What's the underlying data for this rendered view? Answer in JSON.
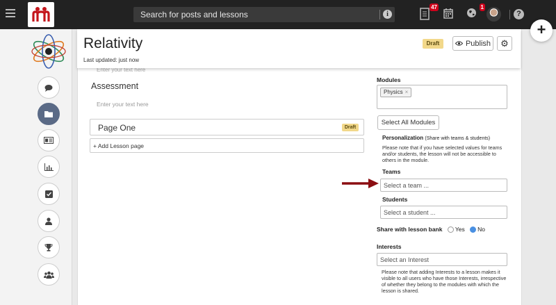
{
  "topbar": {
    "search_placeholder": "Search for posts and lessons",
    "info_glyph": "i",
    "notifications_count": "47",
    "globe_count": "1",
    "help_glyph": "?",
    "icons": [
      "hamburger-icon",
      "logo-icon",
      "info-icon",
      "notifications-icon",
      "calendar-icon",
      "globe-icon",
      "avatar",
      "help-icon"
    ]
  },
  "fab": {
    "label": "+"
  },
  "lesson": {
    "title": "Relativity",
    "last_updated": "Last updated: just now",
    "status": "Draft",
    "publish_label": "Publish",
    "faded_text": "Enter your text here"
  },
  "assessment": {
    "title": "Assessment",
    "placeholder": "Enter your text here"
  },
  "pages": [
    {
      "label": "Page One",
      "status": "Draft"
    }
  ],
  "add_page_label": "+ Add Lesson page",
  "modules": {
    "label": "Modules",
    "selected": [
      "Physics"
    ],
    "chip_remove": "×",
    "select_all_label": "Select All Modules"
  },
  "personalization": {
    "title": "Personalization",
    "subtitle": "(Share with teams & students)",
    "note": "Please note that if you have selected values for teams and/or students, the lesson will not be accessible to others in the module.",
    "teams_label": "Teams",
    "teams_placeholder": "Select a team ...",
    "students_label": "Students",
    "students_placeholder": "Select a student ..."
  },
  "share": {
    "label": "Share with lesson bank",
    "yes_label": "Yes",
    "no_label": "No",
    "selected": "No"
  },
  "interests": {
    "label": "Interests",
    "placeholder": "Select an Interest",
    "note": "Please note that adding Interests to a lesson makes it visible to all users who have those Interests, irrespective of whether they belong to the modules with which the lesson is shared."
  },
  "leftnav": {
    "items": [
      "comment-icon",
      "folder-icon",
      "id-card-icon",
      "bar-chart-icon",
      "checkbox-icon",
      "user-icon",
      "trophy-icon",
      "group-icon"
    ],
    "active": "folder-icon"
  },
  "colors": {
    "topbar": "#222222",
    "nav_active": "#5a6a86",
    "draft_badge": "#f2d88a",
    "arrow": "#8b0e12",
    "radio_selected": "#4a90e2"
  }
}
